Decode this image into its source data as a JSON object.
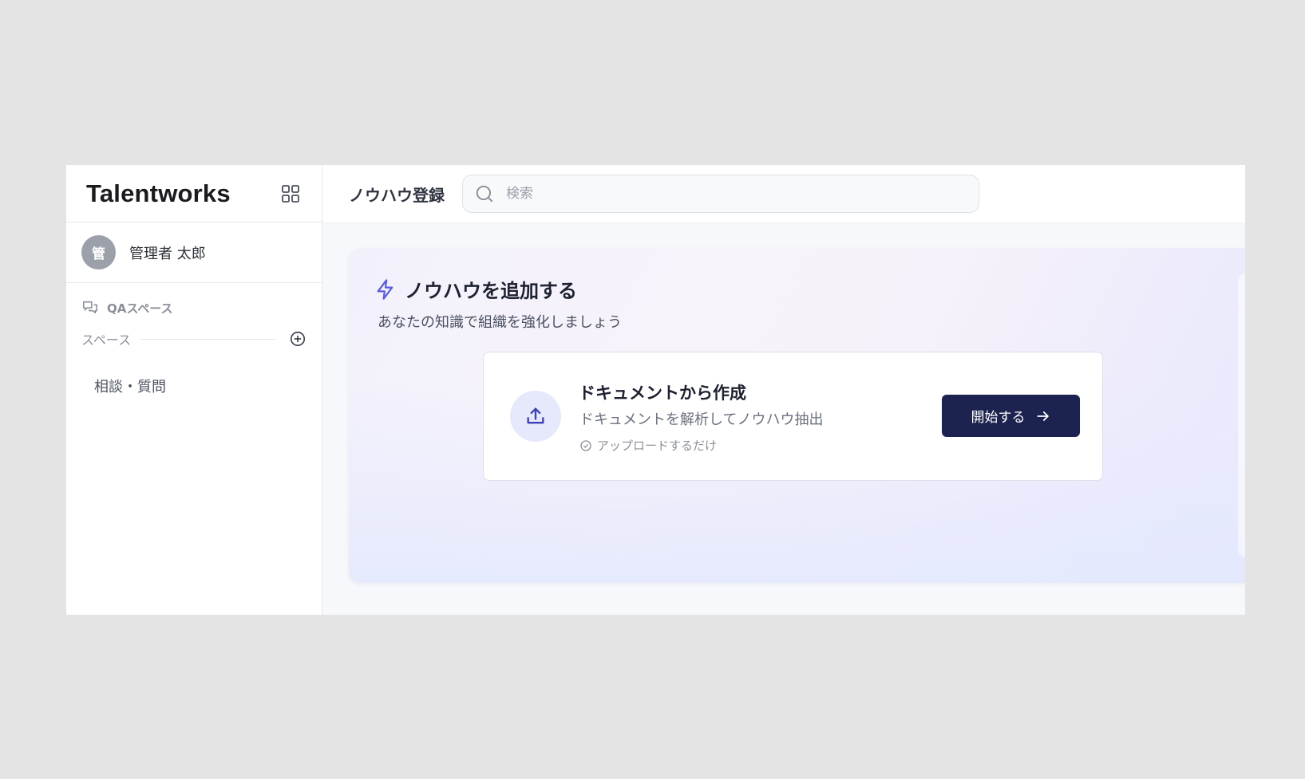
{
  "sidebar": {
    "brand": "Talentworks",
    "user": {
      "avatar_initial": "管",
      "name": "管理者 太郎"
    },
    "qa_section_label": "QAスペース",
    "spaces_label": "スペース",
    "items": [
      {
        "label": "相談・質問"
      }
    ]
  },
  "header": {
    "title": "ノウハウ登録",
    "search_placeholder": "検索",
    "search_value": ""
  },
  "hero": {
    "title": "ノウハウを追加する",
    "subtitle": "あなたの知識で組織を強化しましょう",
    "card": {
      "title": "ドキュメントから作成",
      "description": "ドキュメントを解析してノウハウ抽出",
      "note": "アップロードするだけ",
      "button_label": "開始する"
    }
  },
  "colors": {
    "accent": "#5b5ce6",
    "button_bg": "#1c2350",
    "avatar_bg": "#9ca0a8"
  }
}
